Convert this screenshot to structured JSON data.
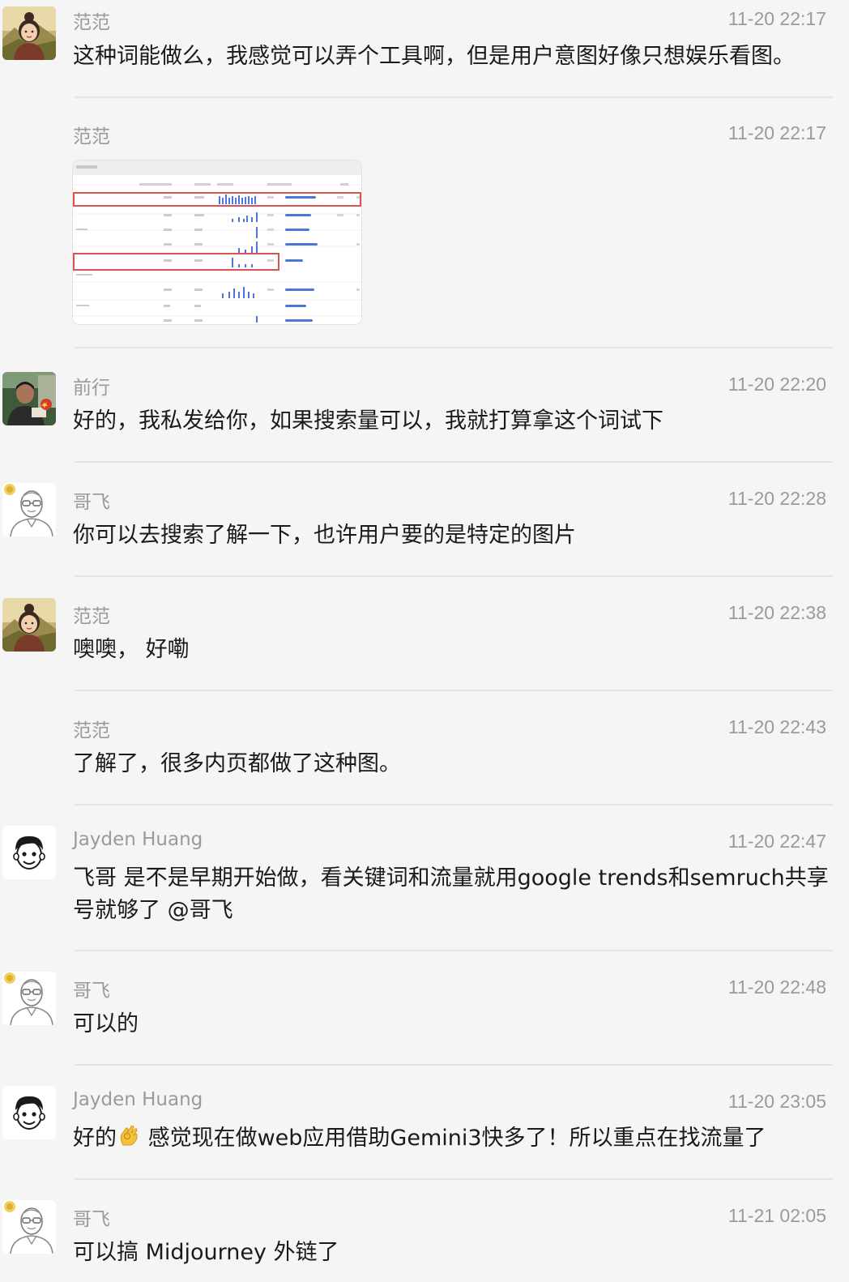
{
  "messages": [
    {
      "sender": "范范",
      "time": "11-20 22:17",
      "text": "这种词能做么，我感觉可以弄个工具啊，但是用户意图好像只想娱乐看图。",
      "avatar": "landscape-girl-avatar"
    },
    {
      "sender": "范范",
      "time": "11-20 22:17",
      "text": "",
      "image": "spreadsheet-screenshot-thumbnail"
    },
    {
      "sender": "前行",
      "time": "11-20 22:20",
      "text": "好的，我私发给你，如果搜索量可以，我就打算拿这个词试下",
      "avatar": "photo-man-avatar"
    },
    {
      "sender": "哥飞",
      "time": "11-20 22:28",
      "text": "你可以去搜索了解一下，也许用户要的是特定的图片",
      "avatar": "glasses-man-sketch-avatar"
    },
    {
      "sender": "范范",
      "time": "11-20 22:38",
      "text": "噢噢， 好嘞",
      "avatar": "landscape-girl-avatar"
    },
    {
      "sender": "范范",
      "time": "11-20 22:43",
      "text": "了解了，很多内页都做了这种图。"
    },
    {
      "sender": "Jayden Huang",
      "time": "11-20 22:47",
      "text": "飞哥 是不是早期开始做，看关键词和流量就用google trends和semruch共享号就够了 @哥飞",
      "avatar": "cartoon-boy-avatar"
    },
    {
      "sender": "哥飞",
      "time": "11-20 22:48",
      "text": "可以的",
      "avatar": "glasses-man-sketch-avatar"
    },
    {
      "sender": "Jayden Huang",
      "time": "11-20 23:05",
      "text_before": "好的",
      "emoji": "👌",
      "text_after": " 感觉现在做web应用借助Gemini3快多了！所以重点在找流量了",
      "avatar": "cartoon-boy-avatar"
    },
    {
      "sender": "哥飞",
      "time": "11-21 02:05",
      "text": "可以搞 Midjourney 外链了",
      "avatar": "glasses-man-sketch-avatar"
    }
  ],
  "colors": {
    "background": "#f5f5f5",
    "meta_text": "#9a9a9a",
    "body_text": "#1a1a1a",
    "divider": "#e4e4e4",
    "highlight_box": "#d9534f",
    "bar_blue": "#3b6fd8"
  }
}
